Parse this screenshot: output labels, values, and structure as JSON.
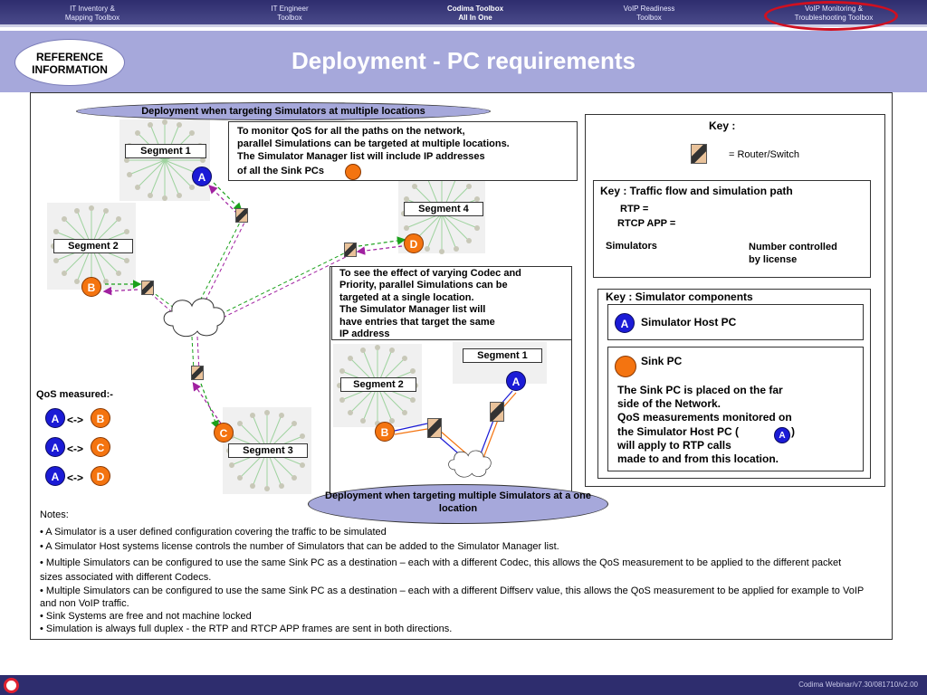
{
  "nav": {
    "tabs": [
      {
        "line1": "IT Inventory &",
        "line2": "Mapping Toolbox"
      },
      {
        "line1": "IT Engineer",
        "line2": "Toolbox"
      },
      {
        "line1": "Codima Toolbox",
        "line2": "All In One"
      },
      {
        "line1": "VoIP Readiness",
        "line2": "Toolbox"
      },
      {
        "line1": "VoIP Monitoring &",
        "line2": "Troubleshooting Toolbox"
      }
    ]
  },
  "banner": {
    "badge_line1": "REFERENCE",
    "badge_line2": "INFORMATION",
    "title": "Deployment - PC requirements"
  },
  "left": {
    "heading": "Deployment when targeting Simulators at multiple locations",
    "callout": [
      "To monitor QoS for all the paths on the network,",
      "parallel Simulations can be targeted at multiple locations.",
      "The Simulator Manager  list will include IP addresses",
      "of all the Sink PCs"
    ],
    "segments": {
      "s1": "Segment 1",
      "s2": "Segment 2",
      "s3": "Segment 3",
      "s4": "Segment 4"
    },
    "nodes": {
      "a": "A",
      "b": "B",
      "c": "C",
      "d": "D"
    },
    "qos_label": "QoS measured:-",
    "qos_arrow": "<->",
    "qos_pairs": [
      [
        "A",
        "B"
      ],
      [
        "A",
        "C"
      ],
      [
        "A",
        "D"
      ]
    ]
  },
  "middle": {
    "callout": [
      "To see the effect of varying Codec and",
      "Priority, parallel Simulations can be",
      "targeted at a single location.",
      "The Simulator Manager  list will",
      "have entries that target the same",
      "IP address"
    ],
    "seg1": "Segment 1",
    "seg2": "Segment 2",
    "node_a": "A",
    "node_b": "B",
    "footer_title": "Deployment when targeting multiple Simulators at a one location"
  },
  "key": {
    "title": "Key :",
    "router_label": "= Router/Switch",
    "traffic_title": "Key :  Traffic flow and simulation path",
    "rtp": "RTP =",
    "rtcp": "RTCP APP =",
    "simulators": "Simulators",
    "number_controlled": [
      "Number controlled",
      "by license"
    ],
    "components_title": "Key :  Simulator components",
    "host_letter": "A",
    "host_label": "Simulator Host PC",
    "sink_label": "Sink PC",
    "sink_desc_1": "The Sink PC is placed on the far",
    "sink_desc_2": "side of the Network.",
    "sink_desc_3": "QoS measurements monitored on",
    "sink_desc_4a": "the Simulator Host PC (",
    "sink_desc_4b": ")",
    "sink_desc_5": "will apply to RTP calls",
    "sink_desc_6": "made to and from this location."
  },
  "notes": {
    "heading": "Notes:",
    "items": [
      "• A Simulator is a user defined configuration covering the traffic to be simulated",
      "• A Simulator Host systems license controls the number of Simulators that can be added to the Simulator Manager list.",
      "• Multiple Simulators can be configured to use the same Sink PC as a destination – each with a different Codec, this allows the QoS measurement to be applied to the different packet sizes associated with different Codecs.",
      "• Multiple Simulators can be configured to use the same Sink PC as a destination  – each with a different Diffserv value, this allows the QoS measurement to be applied for example to VoIP and non VoIP traffic.",
      "• Sink Systems are free and not machine locked",
      "• Simulation is always full duplex - the RTP and RTCP APP frames are sent in both directions."
    ]
  },
  "footer": {
    "text": "Codima Webinar/v7.30/081710/v2.00"
  },
  "colors": {
    "nav_bg": "#2e2d6e",
    "banner": "#a6a8db",
    "rtp": "#1aa01a",
    "rtcp": "#a020a0",
    "host": "#1b1bd6",
    "sink": "#f47410",
    "highlight": "#d01020"
  }
}
